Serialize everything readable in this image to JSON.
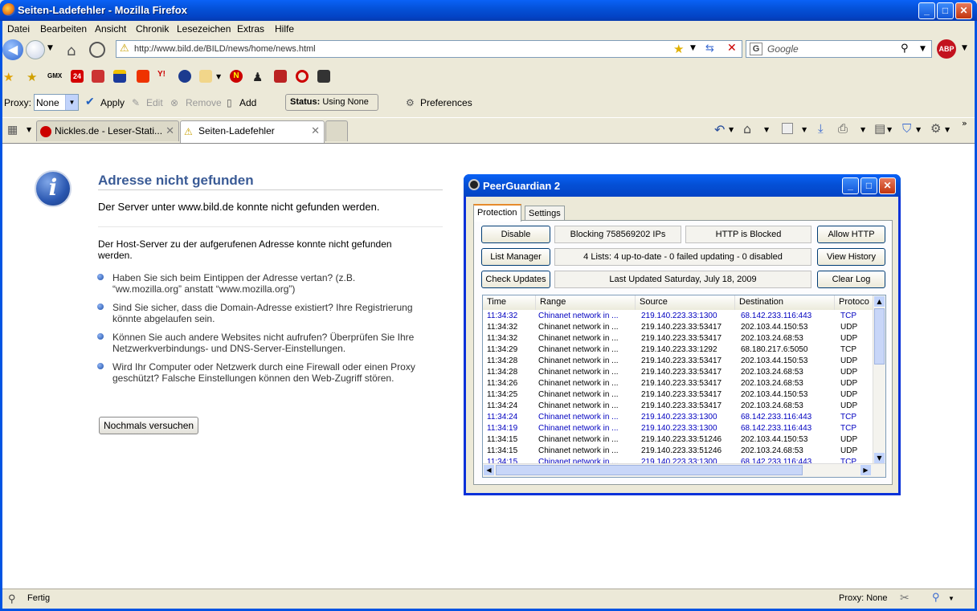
{
  "window": {
    "title": "Seiten-Ladefehler - Mozilla Firefox",
    "min": "_",
    "max": "□",
    "close": "✕"
  },
  "menu": [
    "Datei",
    "Bearbeiten",
    "Ansicht",
    "Chronik",
    "Lesezeichen",
    "Extras",
    "Hilfe"
  ],
  "nav": {
    "url": "http://www.bild.de/BILD/news/home/news.html",
    "search_placeholder": "Google",
    "abp": "ABP"
  },
  "proxybar": {
    "label": "Proxy:",
    "value": "None",
    "apply": "Apply",
    "edit": "Edit",
    "remove": "Remove",
    "add": "Add",
    "status_label": "Status:",
    "status_value": "Using None",
    "preferences": "Preferences"
  },
  "tabs": [
    {
      "label": "Nickles.de - Leser-Stati..."
    },
    {
      "label": "Seiten-Ladefehler"
    }
  ],
  "error": {
    "title": "Adresse nicht gefunden",
    "subtitle": "Der Server unter www.bild.de konnte nicht gefunden werden.",
    "intro": "Der Host-Server zu der aufgerufenen Adresse konnte nicht gefunden werden.",
    "bullets": [
      "Haben Sie sich beim Eintippen der Adresse vertan? (z.B. “ww.mozilla.org” anstatt “www.mozilla.org”)",
      "Sind Sie sicher, dass die Domain-Adresse existiert? Ihre Registrierung könnte abgelaufen sein.",
      "Können Sie auch andere Websites nicht aufrufen? Überprüfen Sie Ihre Netzwerkverbindungs- und DNS-Server-Einstellungen.",
      "Wird Ihr Computer oder Netzwerk durch eine Firewall oder einen Proxy geschützt? Falsche Einstellungen können den Web-Zugriff stören."
    ],
    "retry": "Nochmals versuchen"
  },
  "pg": {
    "title": "PeerGuardian 2",
    "tabs": [
      "Protection",
      "Settings"
    ],
    "buttons": {
      "disable": "Disable",
      "allow_http": "Allow HTTP",
      "list_manager": "List Manager",
      "view_history": "View History",
      "check_updates": "Check Updates",
      "clear_log": "Clear Log"
    },
    "fields": {
      "blocking": "Blocking 758569202 IPs",
      "http": "HTTP is Blocked",
      "lists": "4 Lists: 4 up-to-date - 0 failed updating - 0 disabled",
      "updated": "Last Updated Saturday, July 18, 2009"
    },
    "columns": [
      "Time",
      "Range",
      "Source",
      "Destination",
      "Protoco"
    ],
    "rows": [
      [
        "11:34:32",
        "Chinanet network in ...",
        "219.140.223.33:1300",
        "68.142.233.116:443",
        "TCP",
        "blue"
      ],
      [
        "11:34:32",
        "Chinanet network in ...",
        "219.140.223.33:53417",
        "202.103.44.150:53",
        "UDP",
        "black"
      ],
      [
        "11:34:32",
        "Chinanet network in ...",
        "219.140.223.33:53417",
        "202.103.24.68:53",
        "UDP",
        "black"
      ],
      [
        "11:34:29",
        "Chinanet network in ...",
        "219.140.223.33:1292",
        "68.180.217.6:5050",
        "TCP",
        "black"
      ],
      [
        "11:34:28",
        "Chinanet network in ...",
        "219.140.223.33:53417",
        "202.103.44.150:53",
        "UDP",
        "black"
      ],
      [
        "11:34:28",
        "Chinanet network in ...",
        "219.140.223.33:53417",
        "202.103.24.68:53",
        "UDP",
        "black"
      ],
      [
        "11:34:26",
        "Chinanet network in ...",
        "219.140.223.33:53417",
        "202.103.24.68:53",
        "UDP",
        "black"
      ],
      [
        "11:34:25",
        "Chinanet network in ...",
        "219.140.223.33:53417",
        "202.103.44.150:53",
        "UDP",
        "black"
      ],
      [
        "11:34:24",
        "Chinanet network in ...",
        "219.140.223.33:53417",
        "202.103.24.68:53",
        "UDP",
        "black"
      ],
      [
        "11:34:24",
        "Chinanet network in ...",
        "219.140.223.33:1300",
        "68.142.233.116:443",
        "TCP",
        "blue"
      ],
      [
        "11:34:19",
        "Chinanet network in ...",
        "219.140.223.33:1300",
        "68.142.233.116:443",
        "TCP",
        "blue"
      ],
      [
        "11:34:15",
        "Chinanet network in ...",
        "219.140.223.33:51246",
        "202.103.44.150:53",
        "UDP",
        "black"
      ],
      [
        "11:34:15",
        "Chinanet network in ...",
        "219.140.223.33:51246",
        "202.103.24.68:53",
        "UDP",
        "black"
      ],
      [
        "11:34:15",
        "Chinanet network in ...",
        "219.140.223.33:1300",
        "68.142.233.116:443",
        "TCP",
        "blue"
      ]
    ]
  },
  "status": {
    "text": "Fertig",
    "proxy": "Proxy: None"
  },
  "colors": {
    "link_blue": "#0000c0",
    "title_blue": "#3a5b96"
  }
}
